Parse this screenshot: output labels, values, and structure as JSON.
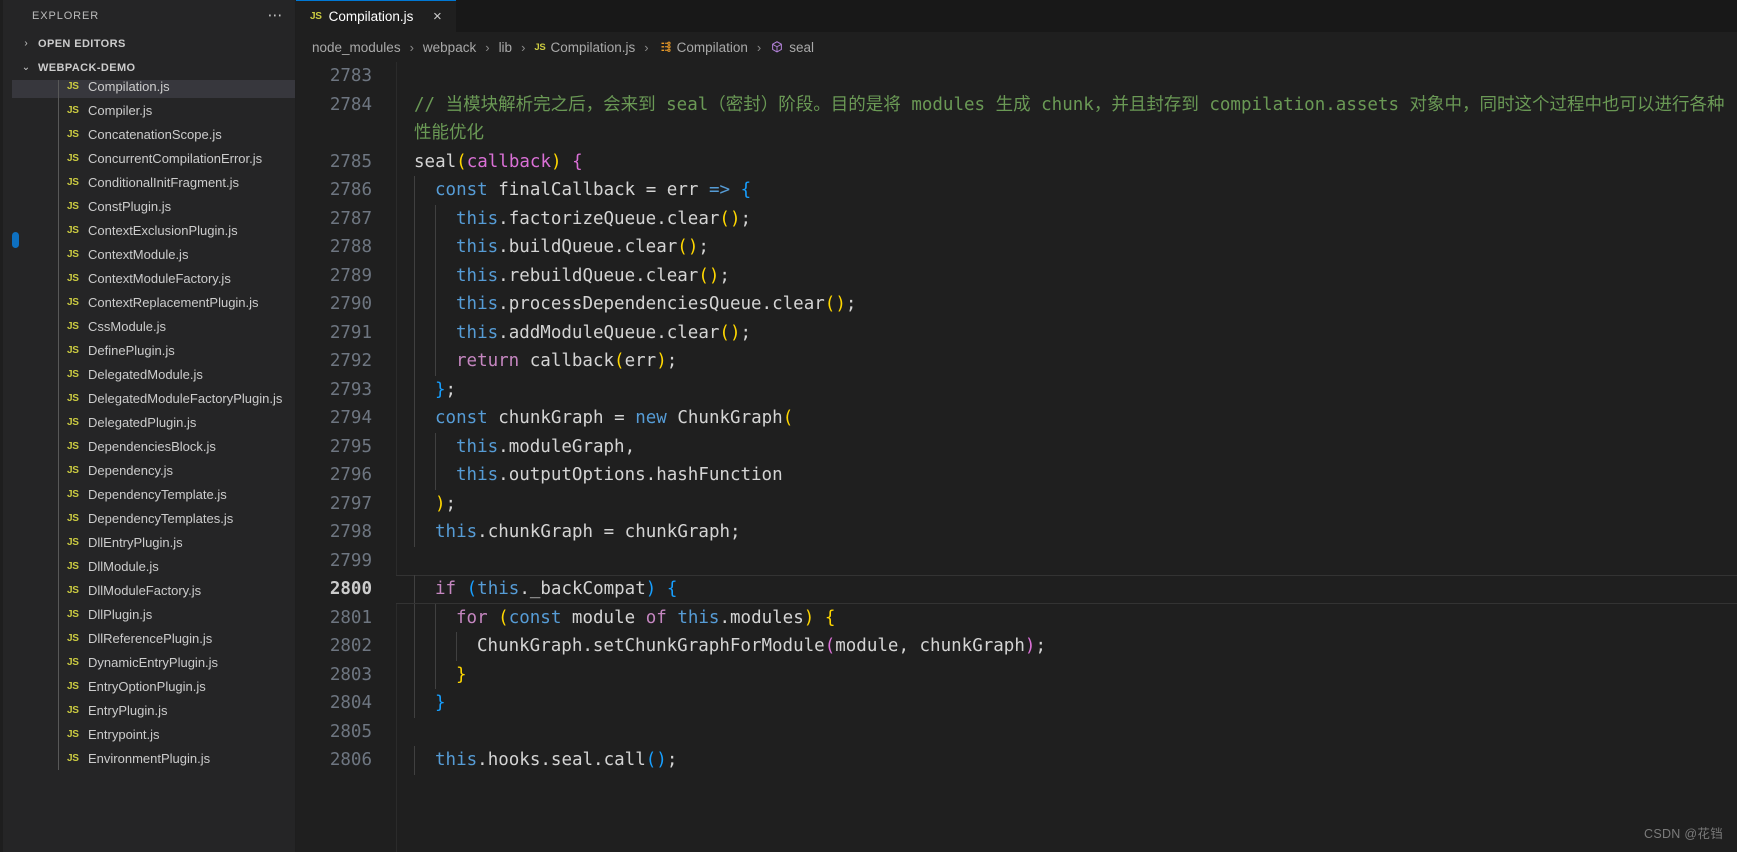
{
  "window": {
    "background": "#1f1f1f",
    "accent": "#0078d4"
  },
  "sidebar": {
    "title": "EXPLORER",
    "more_actions_label": "⋯",
    "sections": [
      {
        "label": "OPEN EDITORS",
        "twisty": "›",
        "expanded": false
      },
      {
        "label": "WEBPACK-DEMO",
        "twisty": "⌄",
        "expanded": true
      }
    ],
    "file_icon_label": "JS",
    "files": [
      {
        "name": "Compilation.js",
        "selected": true
      },
      {
        "name": "Compiler.js",
        "selected": false
      },
      {
        "name": "ConcatenationScope.js",
        "selected": false
      },
      {
        "name": "ConcurrentCompilationError.js",
        "selected": false
      },
      {
        "name": "ConditionalInitFragment.js",
        "selected": false
      },
      {
        "name": "ConstPlugin.js",
        "selected": false
      },
      {
        "name": "ContextExclusionPlugin.js",
        "selected": false
      },
      {
        "name": "ContextModule.js",
        "selected": false
      },
      {
        "name": "ContextModuleFactory.js",
        "selected": false
      },
      {
        "name": "ContextReplacementPlugin.js",
        "selected": false
      },
      {
        "name": "CssModule.js",
        "selected": false
      },
      {
        "name": "DefinePlugin.js",
        "selected": false
      },
      {
        "name": "DelegatedModule.js",
        "selected": false
      },
      {
        "name": "DelegatedModuleFactoryPlugin.js",
        "selected": false
      },
      {
        "name": "DelegatedPlugin.js",
        "selected": false
      },
      {
        "name": "DependenciesBlock.js",
        "selected": false
      },
      {
        "name": "Dependency.js",
        "selected": false
      },
      {
        "name": "DependencyTemplate.js",
        "selected": false
      },
      {
        "name": "DependencyTemplates.js",
        "selected": false
      },
      {
        "name": "DllEntryPlugin.js",
        "selected": false
      },
      {
        "name": "DllModule.js",
        "selected": false
      },
      {
        "name": "DllModuleFactory.js",
        "selected": false
      },
      {
        "name": "DllPlugin.js",
        "selected": false
      },
      {
        "name": "DllReferencePlugin.js",
        "selected": false
      },
      {
        "name": "DynamicEntryPlugin.js",
        "selected": false
      },
      {
        "name": "EntryOptionPlugin.js",
        "selected": false
      },
      {
        "name": "EntryPlugin.js",
        "selected": false
      },
      {
        "name": "Entrypoint.js",
        "selected": false
      },
      {
        "name": "EnvironmentPlugin.js",
        "selected": false
      }
    ]
  },
  "tabs": [
    {
      "icon_label": "JS",
      "label": "Compilation.js",
      "close_label": "×",
      "active": true
    }
  ],
  "breadcrumbs": [
    {
      "label": "node_modules",
      "icon": "none"
    },
    {
      "label": "webpack",
      "icon": "none"
    },
    {
      "label": "lib",
      "icon": "none"
    },
    {
      "label": "Compilation.js",
      "icon": "js",
      "icon_label": "JS"
    },
    {
      "label": "Compilation",
      "icon": "class",
      "icon_label": "⚭"
    },
    {
      "label": "seal",
      "icon": "method",
      "icon_label": "⬡"
    }
  ],
  "breadcrumb_separator": "›",
  "editor": {
    "current_line": 2800,
    "lines": [
      {
        "no": 2783,
        "indent": 0,
        "tokens": []
      },
      {
        "no": 2784,
        "indent": 0,
        "wrap": true,
        "tokens": [
          {
            "t": "// 当模块解析完之后，会来到 seal（密封）阶段。目的是将 modules 生成 chunk，并且封存到 compilation.assets 对象中，同时这个过程中也可以进行各种性能优化",
            "c": "comment"
          }
        ]
      },
      {
        "no": 2785,
        "indent": 0,
        "tokens": [
          {
            "t": "seal",
            "c": "plain"
          },
          {
            "t": "(",
            "c": "paren-y"
          },
          {
            "t": "callback",
            "c": "paren-p"
          },
          {
            "t": ")",
            "c": "paren-y"
          },
          {
            "t": " ",
            "c": "plain"
          },
          {
            "t": "{",
            "c": "paren-p"
          }
        ]
      },
      {
        "no": 2786,
        "indent": 1,
        "tokens": [
          {
            "t": "const",
            "c": "keyword"
          },
          {
            "t": " finalCallback = err ",
            "c": "plain"
          },
          {
            "t": "=>",
            "c": "keyword"
          },
          {
            "t": " ",
            "c": "plain"
          },
          {
            "t": "{",
            "c": "paren-b"
          }
        ]
      },
      {
        "no": 2787,
        "indent": 2,
        "tokens": [
          {
            "t": "this",
            "c": "this"
          },
          {
            "t": ".factorizeQueue.clear",
            "c": "plain"
          },
          {
            "t": "()",
            "c": "paren-y"
          },
          {
            "t": ";",
            "c": "plain"
          }
        ]
      },
      {
        "no": 2788,
        "indent": 2,
        "tokens": [
          {
            "t": "this",
            "c": "this"
          },
          {
            "t": ".buildQueue.clear",
            "c": "plain"
          },
          {
            "t": "()",
            "c": "paren-y"
          },
          {
            "t": ";",
            "c": "plain"
          }
        ]
      },
      {
        "no": 2789,
        "indent": 2,
        "tokens": [
          {
            "t": "this",
            "c": "this"
          },
          {
            "t": ".rebuildQueue.clear",
            "c": "plain"
          },
          {
            "t": "()",
            "c": "paren-y"
          },
          {
            "t": ";",
            "c": "plain"
          }
        ]
      },
      {
        "no": 2790,
        "indent": 2,
        "tokens": [
          {
            "t": "this",
            "c": "this"
          },
          {
            "t": ".processDependenciesQueue.clear",
            "c": "plain"
          },
          {
            "t": "()",
            "c": "paren-y"
          },
          {
            "t": ";",
            "c": "plain"
          }
        ]
      },
      {
        "no": 2791,
        "indent": 2,
        "tokens": [
          {
            "t": "this",
            "c": "this"
          },
          {
            "t": ".addModuleQueue.clear",
            "c": "plain"
          },
          {
            "t": "()",
            "c": "paren-y"
          },
          {
            "t": ";",
            "c": "plain"
          }
        ]
      },
      {
        "no": 2792,
        "indent": 2,
        "tokens": [
          {
            "t": "return",
            "c": "control"
          },
          {
            "t": " callback",
            "c": "plain"
          },
          {
            "t": "(",
            "c": "paren-y"
          },
          {
            "t": "err",
            "c": "plain"
          },
          {
            "t": ")",
            "c": "paren-y"
          },
          {
            "t": ";",
            "c": "plain"
          }
        ]
      },
      {
        "no": 2793,
        "indent": 1,
        "tokens": [
          {
            "t": "}",
            "c": "paren-b"
          },
          {
            "t": ";",
            "c": "plain"
          }
        ]
      },
      {
        "no": 2794,
        "indent": 1,
        "tokens": [
          {
            "t": "const",
            "c": "keyword"
          },
          {
            "t": " chunkGraph = ",
            "c": "plain"
          },
          {
            "t": "new",
            "c": "keyword"
          },
          {
            "t": " ChunkGraph",
            "c": "plain"
          },
          {
            "t": "(",
            "c": "paren-y"
          }
        ]
      },
      {
        "no": 2795,
        "indent": 2,
        "tokens": [
          {
            "t": "this",
            "c": "this"
          },
          {
            "t": ".moduleGraph,",
            "c": "plain"
          }
        ]
      },
      {
        "no": 2796,
        "indent": 2,
        "tokens": [
          {
            "t": "this",
            "c": "this"
          },
          {
            "t": ".outputOptions.hashFunction",
            "c": "plain"
          }
        ]
      },
      {
        "no": 2797,
        "indent": 1,
        "tokens": [
          {
            "t": ")",
            "c": "paren-y"
          },
          {
            "t": ";",
            "c": "plain"
          }
        ]
      },
      {
        "no": 2798,
        "indent": 1,
        "tokens": [
          {
            "t": "this",
            "c": "this"
          },
          {
            "t": ".chunkGraph = chunkGraph;",
            "c": "plain"
          }
        ]
      },
      {
        "no": 2799,
        "indent": 0,
        "tokens": []
      },
      {
        "no": 2800,
        "indent": 1,
        "current": true,
        "tokens": [
          {
            "t": "if",
            "c": "control"
          },
          {
            "t": " ",
            "c": "plain"
          },
          {
            "t": "(",
            "c": "paren-b"
          },
          {
            "t": "this",
            "c": "this"
          },
          {
            "t": "._backCompat",
            "c": "plain"
          },
          {
            "t": ")",
            "c": "paren-b"
          },
          {
            "t": " ",
            "c": "plain"
          },
          {
            "t": "{",
            "c": "paren-b"
          }
        ]
      },
      {
        "no": 2801,
        "indent": 2,
        "tokens": [
          {
            "t": "for",
            "c": "control"
          },
          {
            "t": " ",
            "c": "plain"
          },
          {
            "t": "(",
            "c": "paren-y"
          },
          {
            "t": "const",
            "c": "keyword"
          },
          {
            "t": " module ",
            "c": "plain"
          },
          {
            "t": "of",
            "c": "control"
          },
          {
            "t": " ",
            "c": "plain"
          },
          {
            "t": "this",
            "c": "this"
          },
          {
            "t": ".modules",
            "c": "plain"
          },
          {
            "t": ")",
            "c": "paren-y"
          },
          {
            "t": " ",
            "c": "plain"
          },
          {
            "t": "{",
            "c": "paren-y"
          }
        ]
      },
      {
        "no": 2802,
        "indent": 3,
        "tokens": [
          {
            "t": "ChunkGraph.setChunkGraphForModule",
            "c": "plain"
          },
          {
            "t": "(",
            "c": "paren-p"
          },
          {
            "t": "module, chunkGraph",
            "c": "plain"
          },
          {
            "t": ")",
            "c": "paren-p"
          },
          {
            "t": ";",
            "c": "plain"
          }
        ]
      },
      {
        "no": 2803,
        "indent": 2,
        "tokens": [
          {
            "t": "}",
            "c": "paren-y"
          }
        ]
      },
      {
        "no": 2804,
        "indent": 1,
        "tokens": [
          {
            "t": "}",
            "c": "paren-b"
          }
        ]
      },
      {
        "no": 2805,
        "indent": 0,
        "tokens": []
      },
      {
        "no": 2806,
        "indent": 1,
        "tokens": [
          {
            "t": "this",
            "c": "this"
          },
          {
            "t": ".hooks.seal.call",
            "c": "plain"
          },
          {
            "t": "()",
            "c": "paren-b"
          },
          {
            "t": ";",
            "c": "plain"
          }
        ]
      }
    ]
  },
  "watermark": "CSDN @花铛"
}
